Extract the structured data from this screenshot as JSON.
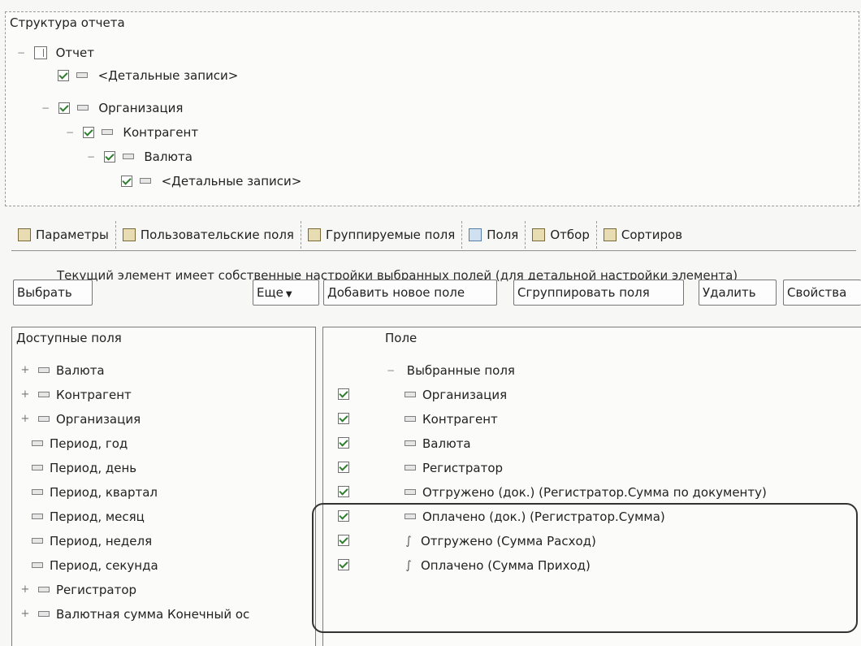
{
  "structure": {
    "title": "Структура отчета",
    "items": [
      {
        "label": "Отчет",
        "icon": "report-icon",
        "checked": false
      },
      {
        "label": "<Детальные записи>",
        "icon": "field-icon",
        "checked": true
      },
      {
        "label": "Организация",
        "icon": "field-icon",
        "checked": true
      },
      {
        "label": "Контрагент",
        "icon": "field-icon",
        "checked": true
      },
      {
        "label": "Валюта",
        "icon": "field-icon",
        "checked": true
      },
      {
        "label": "<Детальные записи>",
        "icon": "field-icon",
        "checked": true
      }
    ]
  },
  "tabs": [
    {
      "label": "Параметры",
      "icon": "parameters-icon"
    },
    {
      "label": "Пользовательские поля",
      "icon": "custom-fields-icon"
    },
    {
      "label": "Группируемые поля",
      "icon": "grouped-fields-icon"
    },
    {
      "label": "Поля",
      "icon": "fields-icon"
    },
    {
      "label": "Отбор",
      "icon": "filter-icon"
    },
    {
      "label": "Сортиров",
      "icon": "sort-icon"
    }
  ],
  "info_text": "Текущий элемент имеет собственные настройки выбранных полей (для детальной настройки элемента)",
  "buttons": {
    "choose": "Выбрать",
    "more": "Еще",
    "add_field": "Добавить новое поле",
    "group_fields": "Сгруппировать поля",
    "delete": "Удалить",
    "properties": "Свойства"
  },
  "available": {
    "header": "Доступные поля",
    "items": [
      {
        "label": "Валюта",
        "expandable": true
      },
      {
        "label": "Контрагент",
        "expandable": true
      },
      {
        "label": "Организация",
        "expandable": true
      },
      {
        "label": "Период, год",
        "expandable": false
      },
      {
        "label": "Период, день",
        "expandable": false
      },
      {
        "label": "Период, квартал",
        "expandable": false
      },
      {
        "label": "Период, месяц",
        "expandable": false
      },
      {
        "label": "Период, неделя",
        "expandable": false
      },
      {
        "label": "Период, секунда",
        "expandable": false
      },
      {
        "label": "Регистратор",
        "expandable": true
      },
      {
        "label": "Валютная сумма Конечный ос",
        "expandable": true
      }
    ]
  },
  "selected": {
    "header": "Поле",
    "group": "Выбранные поля",
    "items": [
      {
        "label": "Организация",
        "type": "field",
        "checked": true
      },
      {
        "label": "Контрагент",
        "type": "field",
        "checked": true
      },
      {
        "label": "Валюта",
        "type": "field",
        "checked": true
      },
      {
        "label": "Регистратор",
        "type": "field",
        "checked": true
      },
      {
        "label": "Отгружено (док.) (Регистратор.Сумма по документу)",
        "type": "field",
        "checked": true
      },
      {
        "label": "Оплачено (док.) (Регистратор.Сумма)",
        "type": "field",
        "checked": true
      },
      {
        "label": "Отгружено (Сумма Расход)",
        "type": "numeric",
        "checked": true
      },
      {
        "label": "Оплачено (Сумма Приход)",
        "type": "numeric",
        "checked": true
      }
    ]
  }
}
